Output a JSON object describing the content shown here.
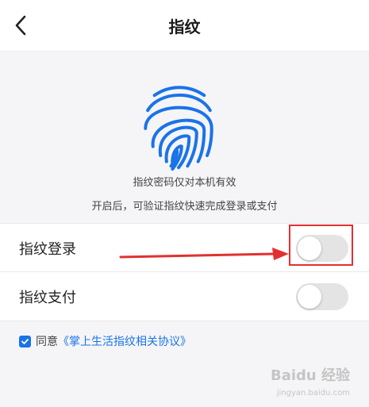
{
  "header": {
    "title": "指纹",
    "back_icon": "chevron-left-icon"
  },
  "hero": {
    "icon": "fingerprint-icon",
    "icon_color": "#1a73e8",
    "info_line_1": "指纹密码仅对本机有效",
    "info_line_2": "开启后，可验证指纹快速完成登录或支付"
  },
  "settings": {
    "items": [
      {
        "label": "指纹登录",
        "enabled": false
      },
      {
        "label": "指纹支付",
        "enabled": false
      }
    ]
  },
  "agreement": {
    "checked": true,
    "prefix": "同意",
    "link": "《掌上生活指纹相关协议》"
  },
  "annotation": {
    "color": "#e23030"
  },
  "watermark": {
    "text": "Baidu 经验",
    "sub": "jingyan.baidu.com"
  }
}
